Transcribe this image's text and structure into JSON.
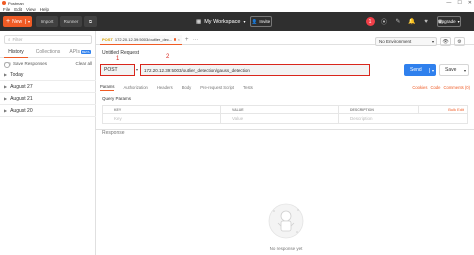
{
  "window": {
    "title": "Postman",
    "controls": [
      "—",
      "☐",
      "✕"
    ]
  },
  "menu": [
    "File",
    "Edit",
    "View",
    "Help"
  ],
  "header": {
    "new_label": "New",
    "import_label": "Import",
    "runner_label": "Runner",
    "workspace_label": "My Workspace",
    "invite_label": "Invite",
    "upgrade_label": "Upgrade",
    "sync_badge": "1"
  },
  "sidebar": {
    "filter_placeholder": "Filter",
    "tabs": [
      "History",
      "Collections",
      "APIs"
    ],
    "apis_badge": "BETA",
    "save_responses_label": "Save Responses",
    "clear_all_label": "Clear all",
    "history": [
      "Today",
      "August 27",
      "August 21",
      "August 20"
    ]
  },
  "request_tab": {
    "method": "POST",
    "url_short": "172.20.12.39:5003/outlier_dec..."
  },
  "environment": {
    "selected": "No Environment"
  },
  "request": {
    "title": "Untitled Request",
    "method": "POST",
    "url": "172.20.12.39:5003/outlier_detection/gauss_detection",
    "send_label": "Send",
    "save_label": "Save",
    "annotation_method": "1",
    "annotation_url": "2"
  },
  "param_tabs": [
    "Params",
    "Authorization",
    "Headers",
    "Body",
    "Pre-request Script",
    "Tests"
  ],
  "param_links": [
    "Cookies",
    "Code",
    "Comments (0)"
  ],
  "query_params": {
    "label": "Query Params",
    "columns": [
      "KEY",
      "VALUE",
      "DESCRIPTION"
    ],
    "bulk_edit": "Bulk Edit",
    "row": [
      "Key",
      "Value",
      "Description"
    ]
  },
  "response": {
    "title": "Response",
    "empty_text": "No response yet"
  },
  "colors": {
    "brand": "#ef5b25",
    "send": "#2f80ed",
    "header_bg": "#2f2f2f",
    "annotation": "#d9261c"
  }
}
